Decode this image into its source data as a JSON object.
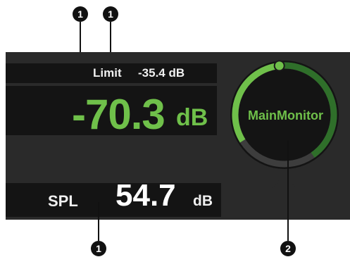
{
  "callouts": {
    "one": "1",
    "two": "2"
  },
  "limit": {
    "label": "Limit",
    "value": "-35.4  dB"
  },
  "level": {
    "value": "-70.3",
    "unit": "dB"
  },
  "spl": {
    "label": "SPL",
    "value": "54.7",
    "unit": "dB"
  },
  "monitor": {
    "name": "MainMonitor",
    "meter_fraction": 0.42
  },
  "colors": {
    "accent": "#6fc04a",
    "panel": "#2a2a2a",
    "dark": "#141414"
  }
}
